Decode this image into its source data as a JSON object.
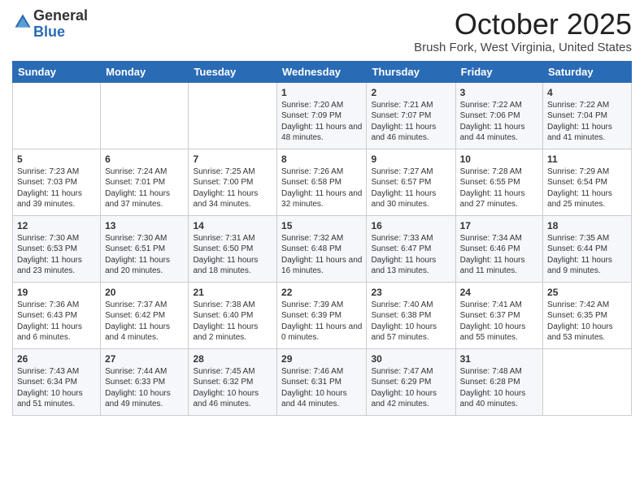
{
  "header": {
    "logo_general": "General",
    "logo_blue": "Blue",
    "month_title": "October 2025",
    "location": "Brush Fork, West Virginia, United States"
  },
  "weekdays": [
    "Sunday",
    "Monday",
    "Tuesday",
    "Wednesday",
    "Thursday",
    "Friday",
    "Saturday"
  ],
  "weeks": [
    [
      {
        "day": "",
        "info": ""
      },
      {
        "day": "",
        "info": ""
      },
      {
        "day": "",
        "info": ""
      },
      {
        "day": "1",
        "info": "Sunrise: 7:20 AM\nSunset: 7:09 PM\nDaylight: 11 hours and 48 minutes."
      },
      {
        "day": "2",
        "info": "Sunrise: 7:21 AM\nSunset: 7:07 PM\nDaylight: 11 hours and 46 minutes."
      },
      {
        "day": "3",
        "info": "Sunrise: 7:22 AM\nSunset: 7:06 PM\nDaylight: 11 hours and 44 minutes."
      },
      {
        "day": "4",
        "info": "Sunrise: 7:22 AM\nSunset: 7:04 PM\nDaylight: 11 hours and 41 minutes."
      }
    ],
    [
      {
        "day": "5",
        "info": "Sunrise: 7:23 AM\nSunset: 7:03 PM\nDaylight: 11 hours and 39 minutes."
      },
      {
        "day": "6",
        "info": "Sunrise: 7:24 AM\nSunset: 7:01 PM\nDaylight: 11 hours and 37 minutes."
      },
      {
        "day": "7",
        "info": "Sunrise: 7:25 AM\nSunset: 7:00 PM\nDaylight: 11 hours and 34 minutes."
      },
      {
        "day": "8",
        "info": "Sunrise: 7:26 AM\nSunset: 6:58 PM\nDaylight: 11 hours and 32 minutes."
      },
      {
        "day": "9",
        "info": "Sunrise: 7:27 AM\nSunset: 6:57 PM\nDaylight: 11 hours and 30 minutes."
      },
      {
        "day": "10",
        "info": "Sunrise: 7:28 AM\nSunset: 6:55 PM\nDaylight: 11 hours and 27 minutes."
      },
      {
        "day": "11",
        "info": "Sunrise: 7:29 AM\nSunset: 6:54 PM\nDaylight: 11 hours and 25 minutes."
      }
    ],
    [
      {
        "day": "12",
        "info": "Sunrise: 7:30 AM\nSunset: 6:53 PM\nDaylight: 11 hours and 23 minutes."
      },
      {
        "day": "13",
        "info": "Sunrise: 7:30 AM\nSunset: 6:51 PM\nDaylight: 11 hours and 20 minutes."
      },
      {
        "day": "14",
        "info": "Sunrise: 7:31 AM\nSunset: 6:50 PM\nDaylight: 11 hours and 18 minutes."
      },
      {
        "day": "15",
        "info": "Sunrise: 7:32 AM\nSunset: 6:48 PM\nDaylight: 11 hours and 16 minutes."
      },
      {
        "day": "16",
        "info": "Sunrise: 7:33 AM\nSunset: 6:47 PM\nDaylight: 11 hours and 13 minutes."
      },
      {
        "day": "17",
        "info": "Sunrise: 7:34 AM\nSunset: 6:46 PM\nDaylight: 11 hours and 11 minutes."
      },
      {
        "day": "18",
        "info": "Sunrise: 7:35 AM\nSunset: 6:44 PM\nDaylight: 11 hours and 9 minutes."
      }
    ],
    [
      {
        "day": "19",
        "info": "Sunrise: 7:36 AM\nSunset: 6:43 PM\nDaylight: 11 hours and 6 minutes."
      },
      {
        "day": "20",
        "info": "Sunrise: 7:37 AM\nSunset: 6:42 PM\nDaylight: 11 hours and 4 minutes."
      },
      {
        "day": "21",
        "info": "Sunrise: 7:38 AM\nSunset: 6:40 PM\nDaylight: 11 hours and 2 minutes."
      },
      {
        "day": "22",
        "info": "Sunrise: 7:39 AM\nSunset: 6:39 PM\nDaylight: 11 hours and 0 minutes."
      },
      {
        "day": "23",
        "info": "Sunrise: 7:40 AM\nSunset: 6:38 PM\nDaylight: 10 hours and 57 minutes."
      },
      {
        "day": "24",
        "info": "Sunrise: 7:41 AM\nSunset: 6:37 PM\nDaylight: 10 hours and 55 minutes."
      },
      {
        "day": "25",
        "info": "Sunrise: 7:42 AM\nSunset: 6:35 PM\nDaylight: 10 hours and 53 minutes."
      }
    ],
    [
      {
        "day": "26",
        "info": "Sunrise: 7:43 AM\nSunset: 6:34 PM\nDaylight: 10 hours and 51 minutes."
      },
      {
        "day": "27",
        "info": "Sunrise: 7:44 AM\nSunset: 6:33 PM\nDaylight: 10 hours and 49 minutes."
      },
      {
        "day": "28",
        "info": "Sunrise: 7:45 AM\nSunset: 6:32 PM\nDaylight: 10 hours and 46 minutes."
      },
      {
        "day": "29",
        "info": "Sunrise: 7:46 AM\nSunset: 6:31 PM\nDaylight: 10 hours and 44 minutes."
      },
      {
        "day": "30",
        "info": "Sunrise: 7:47 AM\nSunset: 6:29 PM\nDaylight: 10 hours and 42 minutes."
      },
      {
        "day": "31",
        "info": "Sunrise: 7:48 AM\nSunset: 6:28 PM\nDaylight: 10 hours and 40 minutes."
      },
      {
        "day": "",
        "info": ""
      }
    ]
  ]
}
